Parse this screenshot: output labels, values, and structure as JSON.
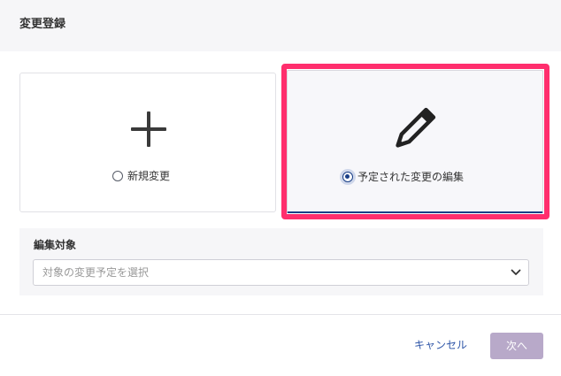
{
  "dialog": {
    "title": "変更登録"
  },
  "options": {
    "new_change": {
      "label": "新規変更",
      "selected": false,
      "icon": "plus-icon"
    },
    "edit_scheduled": {
      "label": "予定された変更の編集",
      "selected": true,
      "icon": "pencil-icon"
    }
  },
  "edit_target": {
    "label": "編集対象",
    "placeholder": "対象の変更予定を選択"
  },
  "footer": {
    "cancel_label": "キャンセル",
    "next_label": "次へ",
    "next_enabled": false
  },
  "colors": {
    "accent": "#1a3f87",
    "link": "#2f56a8",
    "highlight": "#ff2e6d",
    "disabled_button": "#b8a9c9",
    "panel_background": "#f6f6f8"
  }
}
